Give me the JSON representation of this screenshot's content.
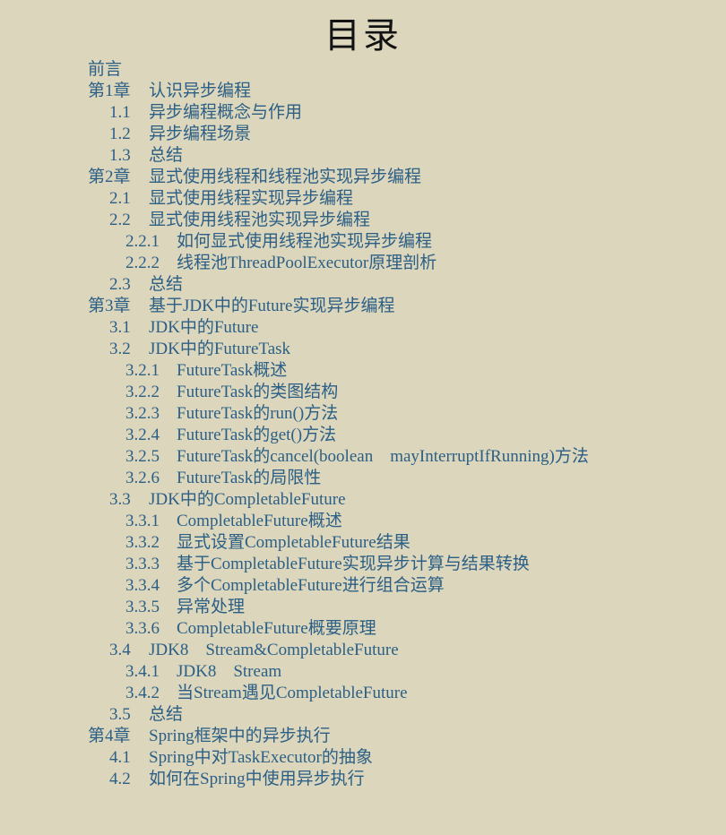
{
  "document": {
    "title": "目录",
    "background_color": "#dcd6bc",
    "title_color": "#121212",
    "entry_color": "#2b5f86"
  },
  "toc": {
    "entries": [
      {
        "level": 0,
        "number": "",
        "label": "前言"
      },
      {
        "level": 0,
        "number": "第1章",
        "label": "认识异步编程"
      },
      {
        "level": 1,
        "number": "1.1",
        "label": "异步编程概念与作用"
      },
      {
        "level": 1,
        "number": "1.2",
        "label": "异步编程场景"
      },
      {
        "level": 1,
        "number": "1.3",
        "label": "总结"
      },
      {
        "level": 0,
        "number": "第2章",
        "label": "显式使用线程和线程池实现异步编程"
      },
      {
        "level": 1,
        "number": "2.1",
        "label": "显式使用线程实现异步编程"
      },
      {
        "level": 1,
        "number": "2.2",
        "label": "显式使用线程池实现异步编程"
      },
      {
        "level": 2,
        "number": "2.2.1",
        "label": "如何显式使用线程池实现异步编程"
      },
      {
        "level": 2,
        "number": "2.2.2",
        "label": "线程池ThreadPoolExecutor原理剖析"
      },
      {
        "level": 1,
        "number": "2.3",
        "label": "总结"
      },
      {
        "level": 0,
        "number": "第3章",
        "label": "基于JDK中的Future实现异步编程"
      },
      {
        "level": 1,
        "number": "3.1",
        "label": "JDK中的Future"
      },
      {
        "level": 1,
        "number": "3.2",
        "label": "JDK中的FutureTask"
      },
      {
        "level": 2,
        "number": "3.2.1",
        "label": "FutureTask概述"
      },
      {
        "level": 2,
        "number": "3.2.2",
        "label": "FutureTask的类图结构"
      },
      {
        "level": 2,
        "number": "3.2.3",
        "label": "FutureTask的run()方法"
      },
      {
        "level": 2,
        "number": "3.2.4",
        "label": "FutureTask的get()方法"
      },
      {
        "level": 2,
        "number": "3.2.5",
        "label": "FutureTask的cancel(boolean    mayInterruptIfRunning)方法"
      },
      {
        "level": 2,
        "number": "3.2.6",
        "label": "FutureTask的局限性"
      },
      {
        "level": 1,
        "number": "3.3",
        "label": "JDK中的CompletableFuture"
      },
      {
        "level": 2,
        "number": "3.3.1",
        "label": "CompletableFuture概述"
      },
      {
        "level": 2,
        "number": "3.3.2",
        "label": "显式设置CompletableFuture结果"
      },
      {
        "level": 2,
        "number": "3.3.3",
        "label": "基于CompletableFuture实现异步计算与结果转换"
      },
      {
        "level": 2,
        "number": "3.3.4",
        "label": "多个CompletableFuture进行组合运算"
      },
      {
        "level": 2,
        "number": "3.3.5",
        "label": "异常处理"
      },
      {
        "level": 2,
        "number": "3.3.6",
        "label": "CompletableFuture概要原理"
      },
      {
        "level": 1,
        "number": "3.4",
        "label": "JDK8    Stream&CompletableFuture"
      },
      {
        "level": 2,
        "number": "3.4.1",
        "label": "JDK8    Stream"
      },
      {
        "level": 2,
        "number": "3.4.2",
        "label": "当Stream遇见CompletableFuture"
      },
      {
        "level": 1,
        "number": "3.5",
        "label": "总结"
      },
      {
        "level": 0,
        "number": "第4章",
        "label": "Spring框架中的异步执行"
      },
      {
        "level": 1,
        "number": "4.1",
        "label": "Spring中对TaskExecutor的抽象"
      },
      {
        "level": 1,
        "number": "4.2",
        "label": "如何在Spring中使用异步执行"
      }
    ]
  }
}
